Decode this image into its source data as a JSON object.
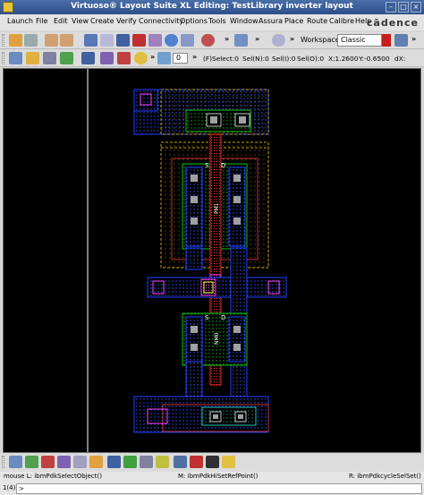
{
  "window": {
    "title": "Virtuoso® Layout Suite XL Editing: TestLibrary inverter layout",
    "controls": [
      "–",
      "□",
      "×"
    ]
  },
  "menu": {
    "items": [
      "Launch",
      "File",
      "Edit",
      "View",
      "Create",
      "Verify",
      "Connectivity",
      "Options",
      "Tools",
      "Window",
      "Assura",
      "Place",
      "Route",
      "Calibre",
      "Help"
    ],
    "logo": "cādence"
  },
  "toolbar1": {
    "workspace_label": "Workspace:",
    "workspace_value": "Classic",
    "more": "»"
  },
  "toolbar2": {
    "zoom_value": "0",
    "select_status": "(F)Select:0",
    "seln": "Sel(N):0",
    "seli": "Sel(I):0",
    "selo": "Sel(O):0",
    "x": "X:1.2600",
    "y": "Y:-0.6500",
    "dx": "dX:"
  },
  "layout": {
    "labels": {
      "pmos_s": "S",
      "pmos_d": "D",
      "pmos_name": "PM1",
      "nmos_s": "S",
      "nmos_d": "D",
      "nmos_name": "NM0"
    },
    "colors": {
      "background": "#000000",
      "nwell": "#ffd700",
      "poly": "#ff2020",
      "metal1": "#2040ff",
      "diff": "#00a000",
      "contact": "#c0c0c0",
      "via": "#ff00ff"
    }
  },
  "status": {
    "mouse_left": "mouse L: ibmPdkSelectObject()",
    "mouse_middle": "M: ibmPdkHiSetRefPoint()",
    "mouse_right": "R: ibmPdkcycleSelSet()"
  },
  "cmd": {
    "line_number": "1(4)",
    "prompt": ">"
  }
}
